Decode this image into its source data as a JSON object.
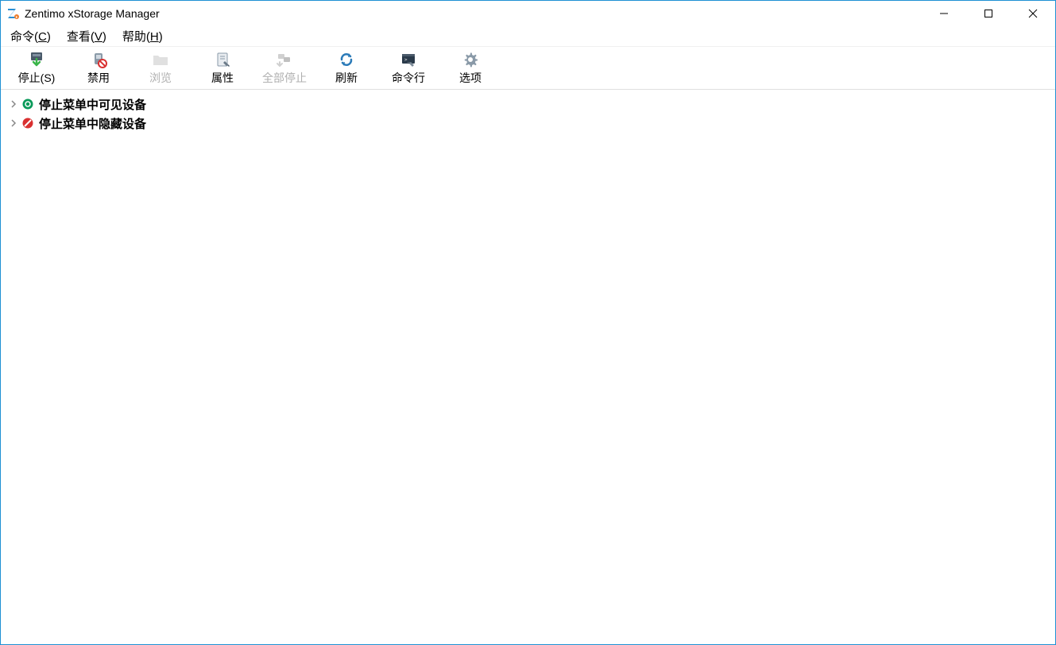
{
  "window": {
    "title": "Zentimo xStorage Manager"
  },
  "menubar": {
    "command": {
      "prefix": "命令(",
      "accel": "C",
      "suffix": ")"
    },
    "view": {
      "prefix": "查看(",
      "accel": "V",
      "suffix": ")"
    },
    "help": {
      "prefix": "帮助(",
      "accel": "H",
      "suffix": ")"
    }
  },
  "toolbar": {
    "stop": {
      "prefix": "停止(",
      "accel": "S",
      "suffix": ")"
    },
    "disable": "禁用",
    "browse": "浏览",
    "properties": "属性",
    "stop_all": "全部停止",
    "refresh": "刷新",
    "cmdline": "命令行",
    "options": "选项"
  },
  "tree": {
    "visible_devices": "停止菜单中可见设备",
    "hidden_devices": "停止菜单中隐藏设备"
  }
}
